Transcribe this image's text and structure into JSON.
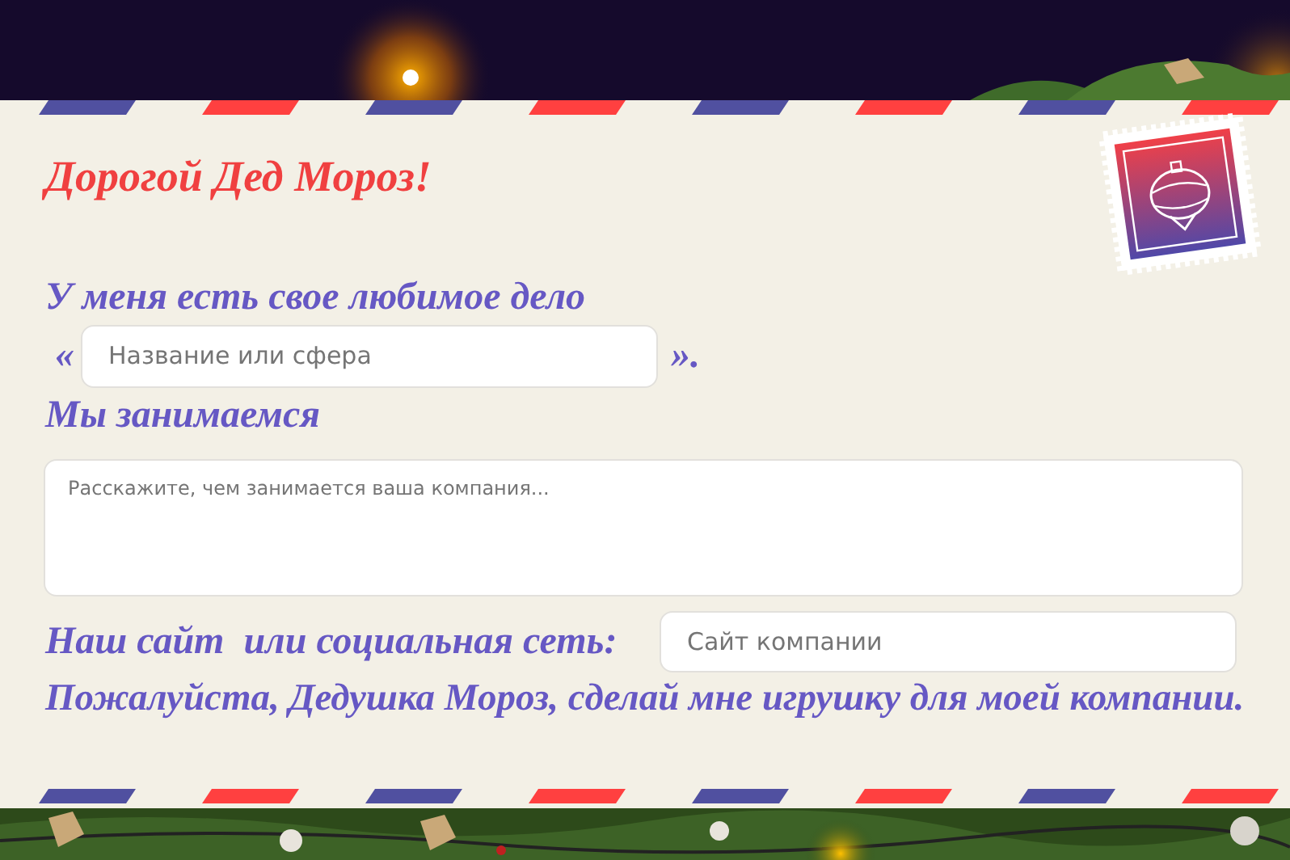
{
  "greeting": "Дорогой Дед Мороз!",
  "line_1": "У меня есть свое любимое дело",
  "quote_open": "«",
  "name_field": {
    "placeholder": "Название или сфера"
  },
  "quote_close": "».",
  "line_2": "Мы занимаемся",
  "description_field": {
    "placeholder": "Расскажите, чем занимается ваша компания..."
  },
  "site_label": "Наш сайт  или социальная сеть:",
  "site_field": {
    "placeholder": "Сайт компании"
  },
  "closing": "Пожалуйста, Дедушка Мороз, сделай мне игрушку для моей компании."
}
